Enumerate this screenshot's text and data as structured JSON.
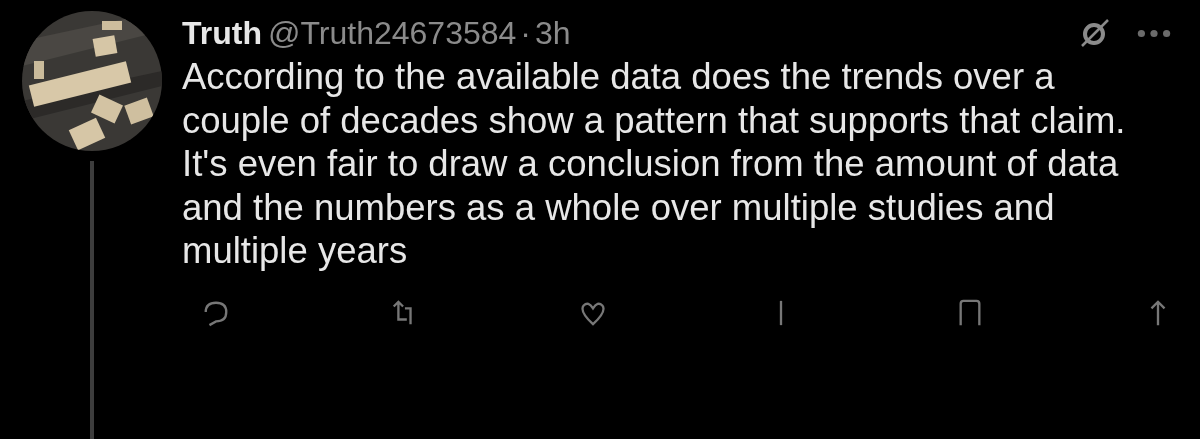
{
  "post": {
    "author": {
      "display_name": "Truth",
      "handle": "@Truth24673584"
    },
    "separator": "·",
    "time": "3h",
    "text": "According to the available data does the trends over a couple of decades show a pattern that supports that claim. It's even fair to draw a conclusion from the amount of data and the numbers as a whole over multiple studies and multiple years",
    "thread_line": true
  }
}
